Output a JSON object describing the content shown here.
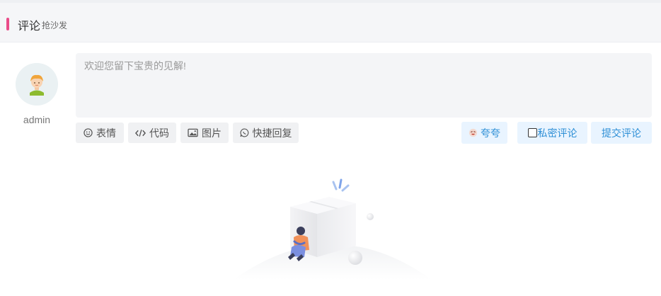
{
  "header": {
    "title": "评论",
    "subtitle": "抢沙发",
    "accent_color": "#ea4c89"
  },
  "user": {
    "name": "admin",
    "avatar_icon": "avatar-girl-icon"
  },
  "comment": {
    "placeholder": "欢迎您留下宝贵的见解!",
    "value": ""
  },
  "toolbar": {
    "emoji": {
      "label": "表情",
      "icon": "smile-icon"
    },
    "code": {
      "label": "代码",
      "icon": "code-icon"
    },
    "image": {
      "label": "图片",
      "icon": "image-icon"
    },
    "quick_reply": {
      "label": "快捷回复",
      "icon": "chat-icon"
    }
  },
  "actions": {
    "praise_label": "夸夸",
    "private_label": "私密评论",
    "private_checked": false,
    "submit_label": "提交评论",
    "accent_color": "#2e8fd6"
  },
  "empty_state": {
    "illustration_icon": "empty-box-illustration-icon"
  }
}
